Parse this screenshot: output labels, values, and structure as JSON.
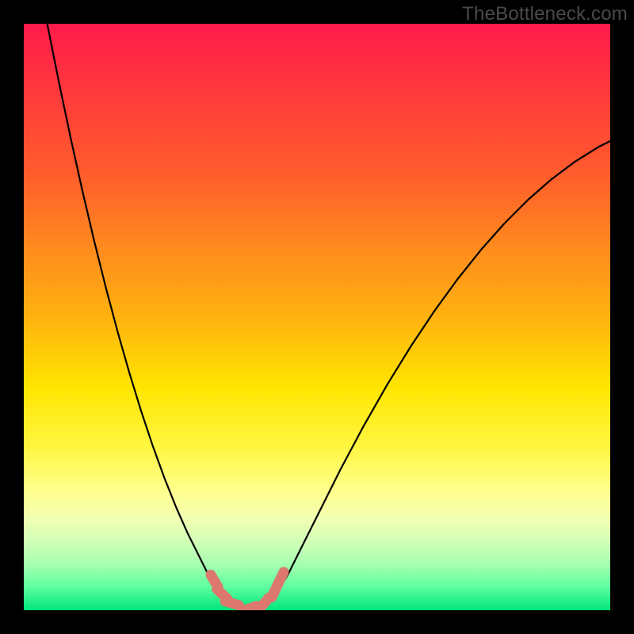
{
  "watermark": "TheBottleneck.com",
  "chart_data": {
    "type": "line",
    "title": "",
    "xlabel": "",
    "ylabel": "",
    "xlim": [
      0,
      100
    ],
    "ylim": [
      0,
      100
    ],
    "grid": false,
    "legend": false,
    "background_gradient": {
      "stops": [
        {
          "offset": 0.0,
          "color": "#ff1a4b"
        },
        {
          "offset": 0.12,
          "color": "#ff3a3c"
        },
        {
          "offset": 0.25,
          "color": "#ff5a2d"
        },
        {
          "offset": 0.38,
          "color": "#ff8a1e"
        },
        {
          "offset": 0.5,
          "color": "#ffb20f"
        },
        {
          "offset": 0.62,
          "color": "#ffe500"
        },
        {
          "offset": 0.72,
          "color": "#fff640"
        },
        {
          "offset": 0.8,
          "color": "#ffff90"
        },
        {
          "offset": 0.84,
          "color": "#f3ffb0"
        },
        {
          "offset": 0.88,
          "color": "#d4ffb8"
        },
        {
          "offset": 0.92,
          "color": "#a8ffb0"
        },
        {
          "offset": 0.96,
          "color": "#5effa0"
        },
        {
          "offset": 1.0,
          "color": "#00e57a"
        }
      ]
    },
    "series": [
      {
        "name": "bottleneck-curve",
        "stroke": "#000000",
        "stroke_width": 2.2,
        "points_xy": [
          [
            4.0,
            100.0
          ],
          [
            6.0,
            90.0
          ],
          [
            8.0,
            80.5
          ],
          [
            10.0,
            71.5
          ],
          [
            12.0,
            63.0
          ],
          [
            14.0,
            55.0
          ],
          [
            16.0,
            47.5
          ],
          [
            18.0,
            40.5
          ],
          [
            20.0,
            34.0
          ],
          [
            22.0,
            28.0
          ],
          [
            24.0,
            22.5
          ],
          [
            26.0,
            17.5
          ],
          [
            28.0,
            13.0
          ],
          [
            30.0,
            9.0
          ],
          [
            31.5,
            6.0
          ],
          [
            33.0,
            3.5
          ],
          [
            34.5,
            1.5
          ],
          [
            36.0,
            0.5
          ],
          [
            37.5,
            0.0
          ],
          [
            39.0,
            0.0
          ],
          [
            40.5,
            0.5
          ],
          [
            42.0,
            1.5
          ],
          [
            43.5,
            3.5
          ],
          [
            45.0,
            6.0
          ],
          [
            47.0,
            10.0
          ],
          [
            50.0,
            16.0
          ],
          [
            54.0,
            24.0
          ],
          [
            58.0,
            31.5
          ],
          [
            62.0,
            38.5
          ],
          [
            66.0,
            45.0
          ],
          [
            70.0,
            51.0
          ],
          [
            74.0,
            56.5
          ],
          [
            78.0,
            61.5
          ],
          [
            82.0,
            66.0
          ],
          [
            86.0,
            70.0
          ],
          [
            90.0,
            73.5
          ],
          [
            94.0,
            76.5
          ],
          [
            98.0,
            79.0
          ],
          [
            100.0,
            80.0
          ]
        ]
      },
      {
        "name": "highlight-dots",
        "stroke": "#dd786f",
        "marker": "round-cap",
        "points_xy": [
          [
            32.5,
            5.0
          ],
          [
            33.8,
            2.8
          ],
          [
            35.5,
            1.2
          ],
          [
            38.5,
            0.3
          ],
          [
            41.0,
            1.2
          ],
          [
            42.8,
            3.3
          ],
          [
            43.8,
            5.4
          ]
        ]
      }
    ]
  }
}
